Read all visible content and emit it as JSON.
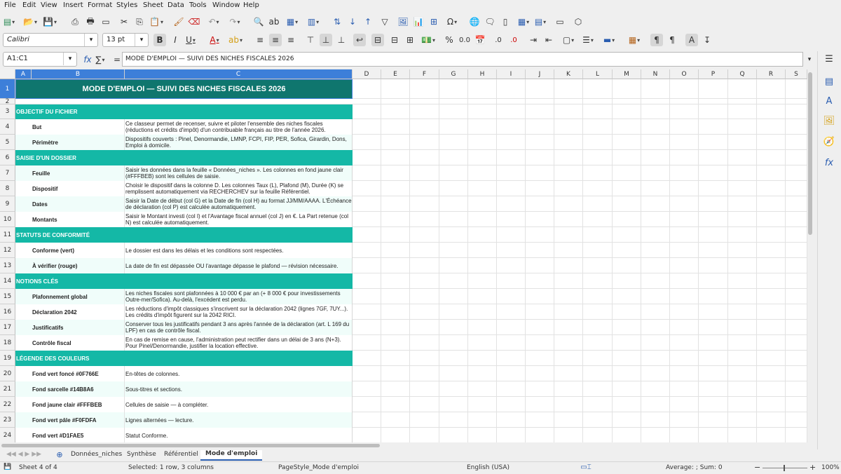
{
  "menu": [
    "File",
    "Edit",
    "View",
    "Insert",
    "Format",
    "Styles",
    "Sheet",
    "Data",
    "Tools",
    "Window",
    "Help"
  ],
  "format": {
    "font_name": "Calibri",
    "font_size": "13 pt"
  },
  "formula": {
    "name_box": "A1:C1",
    "sigma": "∑",
    "equals": "=",
    "content": "MODE D'EMPLOI — SUIVI DES NICHES FISCALES 2026"
  },
  "columns": [
    "A",
    "B",
    "C",
    "D",
    "E",
    "F",
    "G",
    "H",
    "I",
    "J",
    "K",
    "L",
    "M",
    "N",
    "O",
    "P",
    "Q",
    "R",
    "S"
  ],
  "title": "MODE D'EMPLOI — SUIVI DES NICHES FISCALES 2026",
  "rows": [
    {
      "n": "1",
      "type": "title"
    },
    {
      "n": "2",
      "type": "blank"
    },
    {
      "n": "3",
      "type": "section",
      "b": "OBJECTIF DU FICHIER"
    },
    {
      "n": "4",
      "type": "data",
      "b": "But",
      "c": "Ce classeur permet de recenser, suivre et piloter l'ensemble des niches fiscales (réductions et crédits d'impôt) d'un contribuable français au titre de l'année 2026."
    },
    {
      "n": "5",
      "type": "data",
      "b": "Périmètre",
      "c": "Dispositifs couverts : Pinel, Denormandie, LMNP, FCPI, FIP, PER, Sofica, Girardin, Dons, Emploi à domicile."
    },
    {
      "n": "6",
      "type": "section",
      "b": "SAISIE D'UN DOSSIER"
    },
    {
      "n": "7",
      "type": "data",
      "b": "Feuille",
      "c": "Saisir les données dans la feuille « Données_niches ». Les colonnes en fond jaune clair (#FFFBEB) sont les cellules de saisie."
    },
    {
      "n": "8",
      "type": "data",
      "b": "Dispositif",
      "c": "Choisir le dispositif dans la colonne D. Les colonnes Taux (L), Plafond (M), Durée (K) se remplissent automatiquement via RECHERCHEV sur la feuille Référentiel."
    },
    {
      "n": "9",
      "type": "data",
      "b": "Dates",
      "c": "Saisir la Date de début (col G) et la Date de fin (col H) au format JJ/MM/AAAA. L'Échéance de déclaration (col P) est calculée automatiquement."
    },
    {
      "n": "10",
      "type": "data",
      "b": "Montants",
      "c": "Saisir le Montant investi (col I) et l'Avantage fiscal annuel (col J) en €. La Part retenue (col N) est calculée automatiquement."
    },
    {
      "n": "11",
      "type": "section",
      "b": "STATUTS DE CONFORMITÉ"
    },
    {
      "n": "12",
      "type": "data",
      "b": "Conforme (vert)",
      "c": "Le dossier est dans les délais et les conditions sont respectées."
    },
    {
      "n": "13",
      "type": "data",
      "b": "À vérifier (rouge)",
      "c": "La date de fin est dépassée OU l'avantage dépasse le plafond — révision nécessaire."
    },
    {
      "n": "14",
      "type": "section",
      "b": "NOTIONS CLÉS"
    },
    {
      "n": "15",
      "type": "data",
      "b": "Plafonnement global",
      "c": "Les niches fiscales sont plafonnées à 10 000 € par an (+ 8 000 € pour investissements Outre-mer/Sofica). Au-delà, l'excédent est perdu."
    },
    {
      "n": "16",
      "type": "data",
      "b": "Déclaration 2042",
      "c": "Les réductions d'impôt classiques s'inscrivent sur la déclaration 2042 (lignes 7GF, 7UY...). Les crédits d'impôt figurent sur la 2042 RICI."
    },
    {
      "n": "17",
      "type": "data",
      "b": "Justificatifs",
      "c": "Conserver tous les justificatifs pendant 3 ans après l'année de la déclaration (art. L 169 du LPF) en cas de contrôle fiscal."
    },
    {
      "n": "18",
      "type": "data",
      "b": "Contrôle fiscal",
      "c": "En cas de remise en cause, l'administration peut rectifier dans un délai de 3 ans (N+3). Pour Pinel/Denormandie, justifier la location effective."
    },
    {
      "n": "19",
      "type": "section",
      "b": "LÉGENDE DES COULEURS"
    },
    {
      "n": "20",
      "type": "data",
      "b": "Fond vert foncé #0F766E",
      "c": "En-têtes de colonnes."
    },
    {
      "n": "21",
      "type": "data",
      "b": "Fond sarcelle #14B8A6",
      "c": "Sous-titres et sections."
    },
    {
      "n": "22",
      "type": "data",
      "b": "Fond jaune clair #FFFBEB",
      "c": "Cellules de saisie — à compléter."
    },
    {
      "n": "23",
      "type": "data",
      "b": "Fond vert pâle #F0FDFA",
      "c": "Lignes alternées — lecture."
    },
    {
      "n": "24",
      "type": "data",
      "b": "Fond vert #D1FAE5",
      "c": "Statut Conforme."
    }
  ],
  "colors": {
    "title_bg": "#0F766E",
    "section_bg": "#14B8A6",
    "alt_bg": "#F0FDFA",
    "selection": "#3d7fd9"
  },
  "sheet_tabs": [
    "Données_niches",
    "Synthèse",
    "Référentiel",
    "Mode d'emploi"
  ],
  "active_tab": "Mode d'emploi",
  "status": {
    "sheet": "Sheet 4 of 4",
    "selection": "Selected: 1 row, 3 columns",
    "page_style": "PageStyle_Mode d'emploi",
    "language": "English (USA)",
    "stats": "Average: ; Sum: 0",
    "zoom": "100%"
  }
}
